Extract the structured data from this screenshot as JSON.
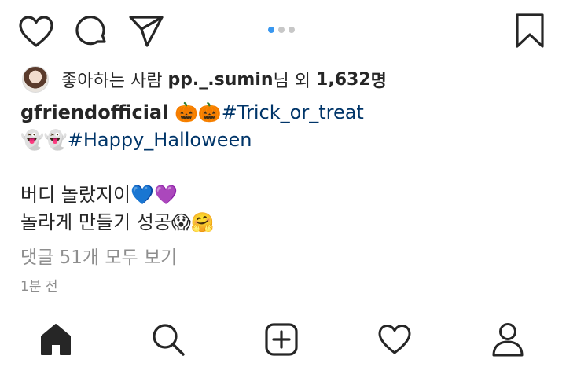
{
  "post": {
    "carousel": {
      "total": 3,
      "active_index": 0,
      "active_color": "#3897f0"
    },
    "likes": {
      "prefix": "좋아하는 사람",
      "user": "pp._.sumin",
      "middle": "님 외",
      "count": "1,632",
      "suffix": "명"
    },
    "caption": {
      "username": "gfriendofficial",
      "line1_emoji": "🎃🎃",
      "hashtag1": "#Trick_or_treat",
      "line2_emoji": "👻👻",
      "hashtag2": "#Happy_Halloween",
      "line3_text": "버디 놀랐지이",
      "line3_emoji": "💙💜",
      "line4_text": "놀라게 만들기 성공",
      "line4_emoji": "😱🤗"
    },
    "comments_link": "댓글 51개 모두 보기",
    "timestamp": "1분 전"
  },
  "icons": {
    "like": "heart-outline-icon",
    "comment": "comment-bubble-icon",
    "share": "paper-plane-icon",
    "save": "bookmark-icon",
    "home": "home-icon",
    "search": "search-icon",
    "add": "add-post-icon",
    "activity": "heart-activity-icon",
    "profile": "profile-icon"
  },
  "colors": {
    "text": "#262626",
    "hashtag": "#003569",
    "muted": "#8e8e8e",
    "dot_inactive": "#c7c7c7"
  }
}
